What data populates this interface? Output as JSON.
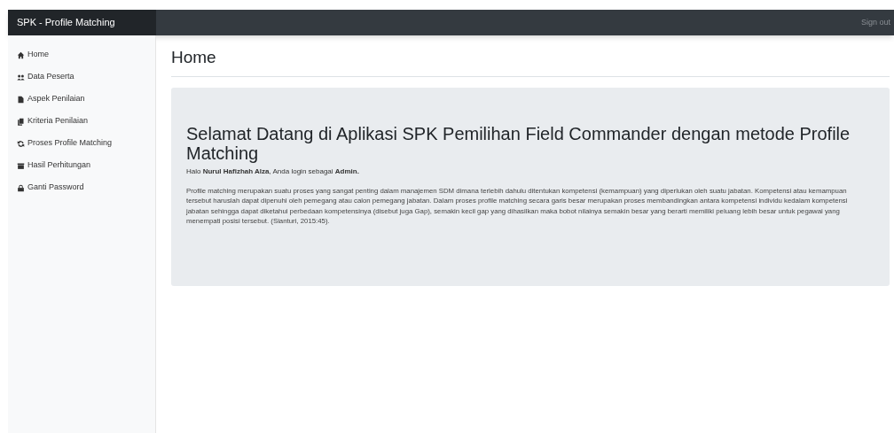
{
  "navbar": {
    "brand": "SPK - Profile Matching",
    "sign_out": "Sign out"
  },
  "sidebar": {
    "items": [
      {
        "label": "Home"
      },
      {
        "label": "Data Peserta"
      },
      {
        "label": "Aspek Penilaian"
      },
      {
        "label": "Kriteria Penilaian"
      },
      {
        "label": "Proses Profile Matching"
      },
      {
        "label": "Hasil Perhitungan"
      },
      {
        "label": "Ganti Password"
      }
    ]
  },
  "page_title": "Home",
  "jumbotron": {
    "heading": "Selamat Datang di Aplikasi SPK Pemilihan Field Commander dengan metode Profile Matching",
    "greeting": "Halo **Nurul Hafizhah Alza**, Anda login sebagai **Admin.**",
    "paragraph": "Profile matching merupakan suatu proses yang sangat penting dalam manajemen SDM dimana terlebih dahulu ditentukan kompetensi (kemampuan) yang diperlukan oleh suatu jabatan. Kompetensi atau kemampuan tersebut haruslah dapat dipenuhi oleh pemegang atau calon pemegang jabatan. Dalam proses profile matching secara garis besar merupakan proses membandingkan antara kompetensi individu kedalam kompetensi jabatan sehingga dapat diketahui perbedaan kompetensinya (disebut juga Gap), semakin kecil gap yang dihasilkan maka bobot nilainya semakin besar yang berarti memiliki peluang lebih besar untuk pegawai yang menempati posisi tersebut. (Sianturi, 2015:45)."
  }
}
